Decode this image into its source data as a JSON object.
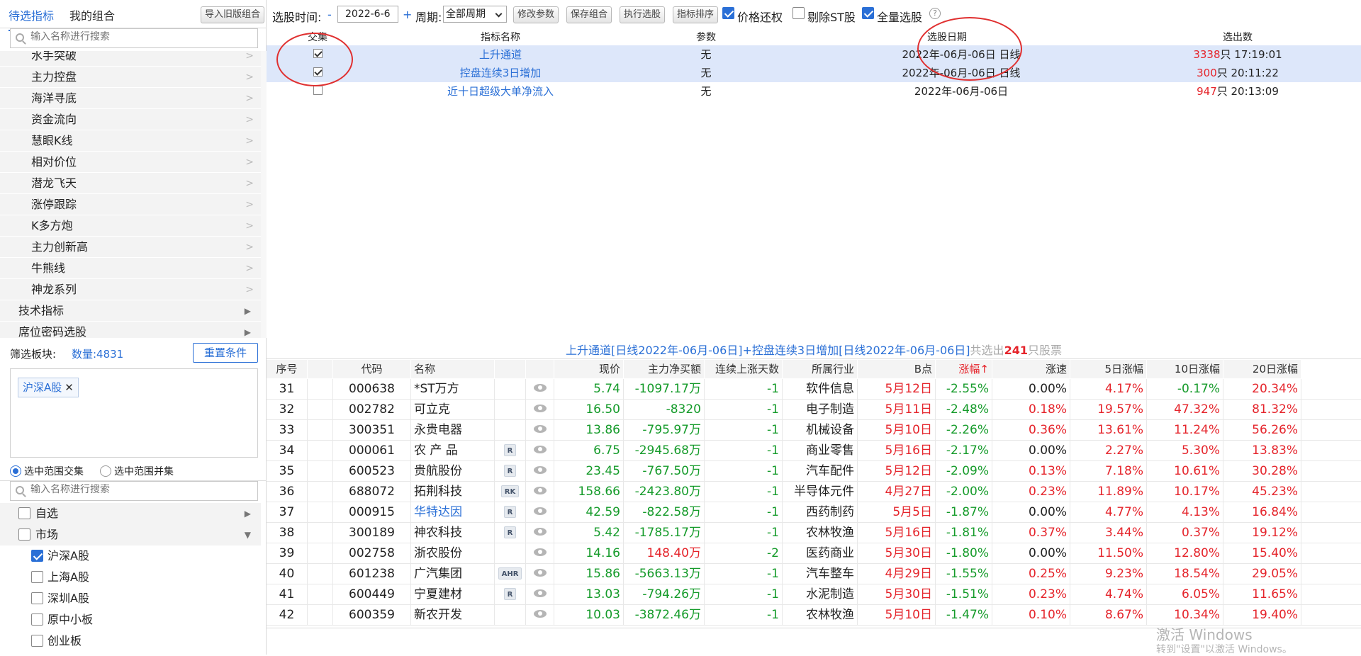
{
  "sidebar": {
    "tab_active": "待选指标",
    "tab_other": "我的组合",
    "import_button": "导入旧版组合",
    "search_placeholder": "输入名称进行搜索",
    "items": [
      "水手突破",
      "主力控盘",
      "海洋寻底",
      "资金流向",
      "慧眼K线",
      "相对价位",
      "潜龙飞天",
      "涨停跟踪",
      "K多方炮",
      "主力创新高",
      "牛熊线",
      "神龙系列"
    ],
    "categories": [
      "技术指标",
      "席位密码选股"
    ],
    "filter_label": "筛选板块:",
    "filter_count": "数量:4831",
    "reset_button": "重置条件",
    "selected_tag": "沪深A股",
    "tag_close": "✕",
    "radio_intersect": "选中范围交集",
    "radio_union": "选中范围并集",
    "search2_placeholder": "输入名称进行搜索",
    "markets": {
      "zixuan": "自选",
      "shichang": "市场",
      "hushen": "沪深A股",
      "shanghai": "上海A股",
      "shenzhen": "深圳A股",
      "yuanzhongxiao": "原中小板",
      "chuangye": "创业板"
    }
  },
  "toolbar": {
    "time_label": "选股时间:",
    "minus": "-",
    "date": "2022-6-6",
    "plus": "+",
    "period_label": "周期:",
    "period_value": "全部周期",
    "btn_modify": "修改参数",
    "btn_save": "保存组合",
    "btn_exec": "执行选股",
    "btn_sort": "指标排序",
    "cb_price": "价格还权",
    "cb_st": "剔除ST股",
    "cb_all": "全量选股",
    "help": "?"
  },
  "indicators": {
    "headers": {
      "jiaoji": "交集",
      "name": "指标名称",
      "param": "参数",
      "date": "选股日期",
      "count": "选出数"
    },
    "rows": [
      {
        "name": "上升通道",
        "param": "无",
        "date": "2022年-06月-06日 日线",
        "num": "3338",
        "unit": "只 17:19:01"
      },
      {
        "name": "控盘连续3日增加",
        "param": "无",
        "date": "2022年-06月-06日 日线",
        "num": "300",
        "unit": "只 20:11:22"
      },
      {
        "name": "近十日超级大单净流入",
        "param": "无",
        "date": "2022年-06月-06日",
        "num": "947",
        "unit": "只 20:13:09"
      }
    ]
  },
  "summary": {
    "text": "上升通道[日线2022年-06月-06日]+控盘连续3日增加[日线2022年-06月-06日]",
    "pre": "共选出",
    "count": "241",
    "post": "只股票"
  },
  "table": {
    "headers": [
      "序号",
      "代码",
      "名称",
      "现价",
      "主力净买额",
      "连续上涨天数",
      "所属行业",
      "B点",
      "涨幅↑",
      "涨速",
      "5日涨幅",
      "10日涨幅",
      "20日涨幅"
    ],
    "rows": [
      {
        "no": "31",
        "code": "000638",
        "name": "*ST万方",
        "badge": "",
        "price": "5.74",
        "net": "-1097.17万",
        "days": "-1",
        "ind": "软件信息",
        "b": "5月12日",
        "chg": "-2.55%",
        "spd": "0.00%",
        "d5": "4.17%",
        "d10": "-0.17%",
        "d20": "20.34%"
      },
      {
        "no": "32",
        "code": "002782",
        "name": "可立克",
        "badge": "",
        "price": "16.50",
        "net": "-8320",
        "days": "-1",
        "ind": "电子制造",
        "b": "5月11日",
        "chg": "-2.48%",
        "spd": "0.18%",
        "d5": "19.57%",
        "d10": "47.32%",
        "d20": "81.32%"
      },
      {
        "no": "33",
        "code": "300351",
        "name": "永贵电器",
        "badge": "",
        "price": "13.86",
        "net": "-795.97万",
        "days": "-1",
        "ind": "机械设备",
        "b": "5月10日",
        "chg": "-2.26%",
        "spd": "0.36%",
        "d5": "13.61%",
        "d10": "11.24%",
        "d20": "56.26%"
      },
      {
        "no": "34",
        "code": "000061",
        "name": "农 产 品",
        "badge": "R",
        "price": "6.75",
        "net": "-2945.68万",
        "days": "-1",
        "ind": "商业零售",
        "b": "5月16日",
        "chg": "-2.17%",
        "spd": "0.00%",
        "d5": "2.27%",
        "d10": "5.30%",
        "d20": "13.83%"
      },
      {
        "no": "35",
        "code": "600523",
        "name": "贵航股份",
        "badge": "R",
        "price": "23.45",
        "net": "-767.50万",
        "days": "-1",
        "ind": "汽车配件",
        "b": "5月12日",
        "chg": "-2.09%",
        "spd": "0.13%",
        "d5": "7.18%",
        "d10": "10.61%",
        "d20": "30.28%"
      },
      {
        "no": "36",
        "code": "688072",
        "name": "拓荆科技",
        "badge": "RK",
        "price": "158.66",
        "net": "-2423.80万",
        "days": "-1",
        "ind": "半导体元件",
        "b": "4月27日",
        "chg": "-2.00%",
        "spd": "0.23%",
        "d5": "11.89%",
        "d10": "10.17%",
        "d20": "45.23%"
      },
      {
        "no": "37",
        "code": "000915",
        "name": "华特达因",
        "badge": "R",
        "price": "42.59",
        "net": "-822.58万",
        "days": "-1",
        "ind": "西药制药",
        "b": "5月5日",
        "chg": "-1.87%",
        "spd": "0.00%",
        "d5": "4.77%",
        "d10": "4.13%",
        "d20": "16.84%"
      },
      {
        "no": "38",
        "code": "300189",
        "name": "神农科技",
        "badge": "R",
        "price": "5.42",
        "net": "-1785.17万",
        "days": "-1",
        "ind": "农林牧渔",
        "b": "5月16日",
        "chg": "-1.81%",
        "spd": "0.37%",
        "d5": "3.44%",
        "d10": "0.37%",
        "d20": "19.12%"
      },
      {
        "no": "39",
        "code": "002758",
        "name": "浙农股份",
        "badge": "",
        "price": "14.16",
        "net": "148.40万",
        "days": "-2",
        "ind": "医药商业",
        "b": "5月30日",
        "chg": "-1.80%",
        "spd": "0.00%",
        "d5": "11.50%",
        "d10": "12.80%",
        "d20": "15.40%"
      },
      {
        "no": "40",
        "code": "601238",
        "name": "广汽集团",
        "badge": "AHR",
        "price": "15.86",
        "net": "-5663.13万",
        "days": "-1",
        "ind": "汽车整车",
        "b": "4月29日",
        "chg": "-1.55%",
        "spd": "0.25%",
        "d5": "9.23%",
        "d10": "18.54%",
        "d20": "29.05%"
      },
      {
        "no": "41",
        "code": "600449",
        "name": "宁夏建材",
        "badge": "R",
        "price": "13.03",
        "net": "-794.26万",
        "days": "-1",
        "ind": "水泥制造",
        "b": "5月30日",
        "chg": "-1.51%",
        "spd": "0.23%",
        "d5": "4.74%",
        "d10": "6.05%",
        "d20": "11.65%"
      },
      {
        "no": "42",
        "code": "600359",
        "name": "新农开发",
        "badge": "",
        "price": "10.03",
        "net": "-3872.46万",
        "days": "-1",
        "ind": "农林牧渔",
        "b": "5月10日",
        "chg": "-1.47%",
        "spd": "0.10%",
        "d5": "8.67%",
        "d10": "10.34%",
        "d20": "19.40%"
      }
    ]
  },
  "watermark": {
    "line1": "激活 Windows",
    "line2": "转到\"设置\"以激活 Windows。"
  },
  "colors": {
    "accent": "#2a6fd6",
    "up": "#e5242b",
    "down": "#159b2a",
    "selected_row": "#dde7fa",
    "annotation": "#e03030"
  }
}
